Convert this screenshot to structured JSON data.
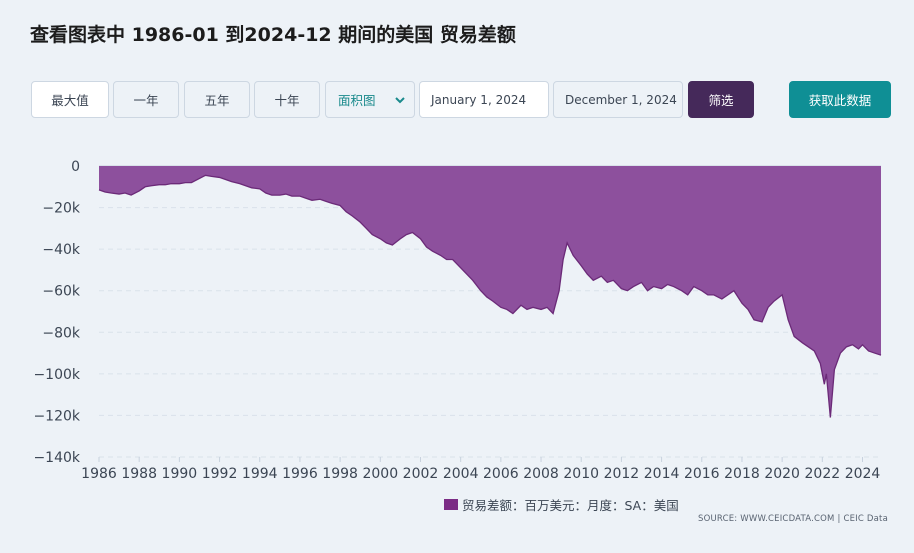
{
  "title": "查看图表中 1986-01 到2024-12 期间的美国 贸易差额",
  "toolbar": {
    "range_buttons": [
      "最大值",
      "一年",
      "五年",
      "十年"
    ],
    "chart_type": "面积图",
    "start_date": "January 1, 2024",
    "end_date": "December 1, 2024",
    "filter_label": "筛选",
    "get_data_label": "获取此数据"
  },
  "legend": {
    "label": "贸易差额：百万美元：月度：SA：美国",
    "color": "#7b2c85"
  },
  "source": "SOURCE: WWW.CEICDATA.COM | CEIC Data",
  "colors": {
    "fill": "#8d509d",
    "line": "#6b2a78",
    "accent": "#0f8f95",
    "dark": "#45295a"
  },
  "icons": {
    "dropdown": "chevron-down-icon"
  },
  "chart_data": {
    "type": "area",
    "title": "查看图表中 1986-01 到2024-12 期间的美国 贸易差额",
    "xlabel": "",
    "ylabel": "",
    "ylim": [
      -140000,
      0
    ],
    "xlim": [
      1986,
      2024.92
    ],
    "yticks": [
      0,
      -20000,
      -40000,
      -60000,
      -80000,
      -100000,
      -120000,
      -140000
    ],
    "ytick_labels": [
      "0",
      "−20k",
      "−40k",
      "−60k",
      "−80k",
      "−100k",
      "−120k",
      "−140k"
    ],
    "xticks": [
      1986,
      1988,
      1990,
      1992,
      1994,
      1996,
      1998,
      2000,
      2002,
      2004,
      2006,
      2008,
      2010,
      2012,
      2014,
      2016,
      2018,
      2020,
      2022,
      2024
    ],
    "grid": true,
    "legend_position": "bottom",
    "series": [
      {
        "name": "贸易差额：百万美元：月度：SA：美国",
        "x": [
          1986.0,
          1986.3,
          1986.6,
          1987.0,
          1987.3,
          1987.6,
          1988.0,
          1988.3,
          1988.6,
          1989.0,
          1989.3,
          1989.6,
          1990.0,
          1990.3,
          1990.6,
          1991.0,
          1991.3,
          1991.6,
          1992.0,
          1992.3,
          1992.6,
          1993.0,
          1993.3,
          1993.6,
          1994.0,
          1994.3,
          1994.6,
          1995.0,
          1995.3,
          1995.6,
          1996.0,
          1996.3,
          1996.6,
          1997.0,
          1997.3,
          1997.6,
          1998.0,
          1998.3,
          1998.6,
          1999.0,
          1999.3,
          1999.6,
          2000.0,
          2000.3,
          2000.6,
          2001.0,
          2001.3,
          2001.6,
          2002.0,
          2002.3,
          2002.6,
          2003.0,
          2003.3,
          2003.6,
          2004.0,
          2004.3,
          2004.6,
          2005.0,
          2005.3,
          2005.6,
          2006.0,
          2006.3,
          2006.6,
          2007.0,
          2007.3,
          2007.6,
          2008.0,
          2008.3,
          2008.6,
          2008.9,
          2009.1,
          2009.3,
          2009.6,
          2010.0,
          2010.3,
          2010.6,
          2011.0,
          2011.3,
          2011.6,
          2012.0,
          2012.3,
          2012.6,
          2013.0,
          2013.3,
          2013.6,
          2014.0,
          2014.3,
          2014.6,
          2015.0,
          2015.3,
          2015.6,
          2016.0,
          2016.3,
          2016.6,
          2017.0,
          2017.3,
          2017.6,
          2018.0,
          2018.3,
          2018.6,
          2019.0,
          2019.3,
          2019.6,
          2020.0,
          2020.3,
          2020.6,
          2021.0,
          2021.3,
          2021.6,
          2021.9,
          2022.1,
          2022.2,
          2022.4,
          2022.6,
          2022.9,
          2023.2,
          2023.5,
          2023.8,
          2024.0,
          2024.3,
          2024.6,
          2024.92
        ],
        "values": [
          -11500,
          -12500,
          -13000,
          -13500,
          -13000,
          -14000,
          -12000,
          -10000,
          -9500,
          -9000,
          -9000,
          -8500,
          -8500,
          -8000,
          -8000,
          -6000,
          -4500,
          -5000,
          -5500,
          -6500,
          -7500,
          -8500,
          -9500,
          -10500,
          -11000,
          -13000,
          -14000,
          -14000,
          -13500,
          -14500,
          -14500,
          -15500,
          -16500,
          -16000,
          -17000,
          -18000,
          -19000,
          -22000,
          -24000,
          -27000,
          -30000,
          -33000,
          -35000,
          -37000,
          -38000,
          -35000,
          -33000,
          -32000,
          -35000,
          -39000,
          -41000,
          -43000,
          -45000,
          -45000,
          -49000,
          -52000,
          -55000,
          -60000,
          -63000,
          -65000,
          -68000,
          -69000,
          -71000,
          -67000,
          -69000,
          -68000,
          -69000,
          -68000,
          -71000,
          -60000,
          -45000,
          -37000,
          -43000,
          -48000,
          -52000,
          -55000,
          -53000,
          -56000,
          -55000,
          -59000,
          -60000,
          -58000,
          -56000,
          -60000,
          -58000,
          -59000,
          -57000,
          -58000,
          -60000,
          -62000,
          -58000,
          -60000,
          -62000,
          -62000,
          -64000,
          -62000,
          -60000,
          -66000,
          -69000,
          -74000,
          -75000,
          -68000,
          -65000,
          -62000,
          -74000,
          -82000,
          -85000,
          -87000,
          -89000,
          -95000,
          -105000,
          -100000,
          -121000,
          -98000,
          -90000,
          -87000,
          -86000,
          -88000,
          -86000,
          -89000,
          -90000,
          -91000
        ]
      }
    ]
  }
}
